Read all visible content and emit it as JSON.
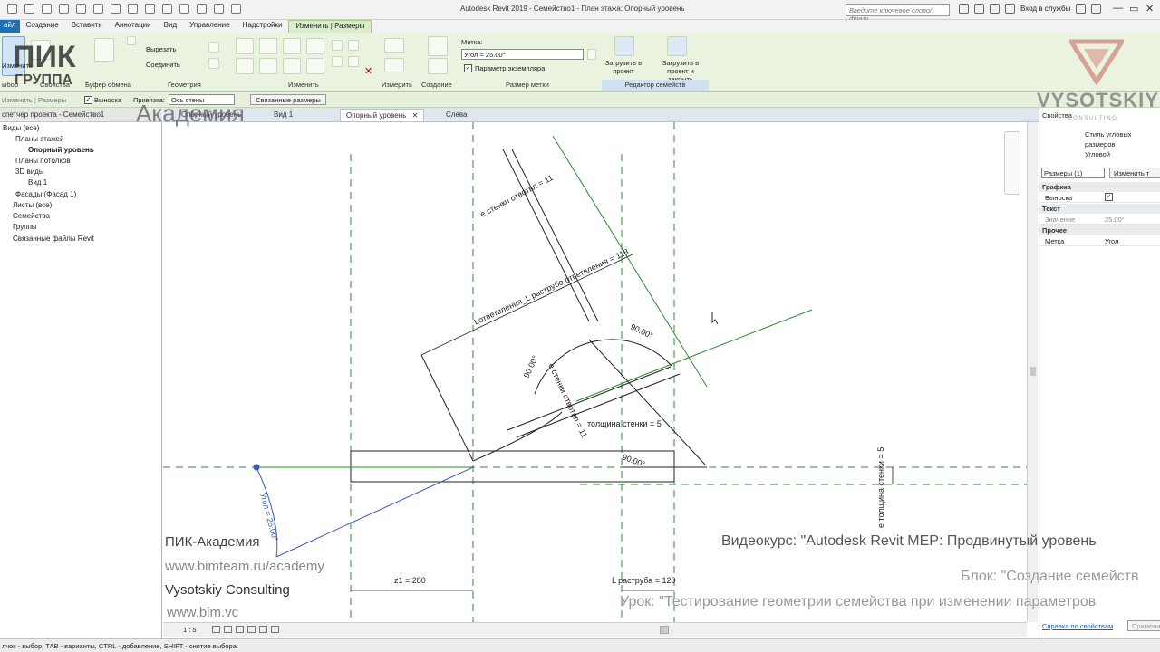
{
  "app": {
    "title": "Autodesk Revit 2019 - Семейство1 - План этажа: Опорный уровень",
    "search_placeholder": "Введите ключевое слово/фразу",
    "signin": "Вход в службы"
  },
  "tabs": [
    "айл",
    "Создание",
    "Вставить",
    "Аннотации",
    "Вид",
    "Управление",
    "Надстройки",
    "Изменить | Размеры"
  ],
  "ribbon": {
    "modify_label": "Изменить",
    "cut_label": "Вырезать",
    "join_label": "Соединить",
    "panels": {
      "select": "ыбор",
      "properties": "Свойства",
      "clipboard": "Буфер обмена",
      "geometry": "Геометрия",
      "modify": "Изменить",
      "measure": "Измерить",
      "create": "Создание",
      "label_size": "Размер метки",
      "family_editor": "Редактор семейств"
    },
    "label_title": "Метка:",
    "label_value": "Угол = 25.00°",
    "instance_param": "Параметр экземпляра",
    "load_into_project": "Загрузить в проект",
    "load_and_close": "Загрузить в проект и закрыть"
  },
  "options_bar": {
    "active_item": "Изменить | Размеры",
    "leader": "Выноска",
    "snap_label": "Привязка:",
    "snap_value": "Ось стены",
    "linked_dims": "Связанные размеры"
  },
  "doc_tabs": [
    {
      "label": "Опорный уровень",
      "active": false
    },
    {
      "label": "Вид 1",
      "active": false
    },
    {
      "label": "Опорный уровень",
      "active": true
    },
    {
      "label": "Слева",
      "active": false
    }
  ],
  "browser": {
    "title": "спетчер проекта - Семейство1",
    "items": [
      {
        "label": "Виды (все)",
        "bold": false
      },
      {
        "label": "Планы этажей",
        "bold": false
      },
      {
        "label": "Опорный уровень",
        "bold": true
      },
      {
        "label": "Планы потолков",
        "bold": false
      },
      {
        "label": "3D виды",
        "bold": false
      },
      {
        "label": "Вид 1",
        "bold": false
      },
      {
        "label": "Фасады (Фасад 1)",
        "bold": false
      },
      {
        "label": "Листы (все)",
        "bold": false
      },
      {
        "label": "Семейства",
        "bold": false
      },
      {
        "label": "Группы",
        "bold": false
      },
      {
        "label": "Связанные файлы Revit",
        "bold": false
      }
    ]
  },
  "properties": {
    "title": "Свойства",
    "type_name": "Стиль угловых размеров",
    "type_sub": "Угловой",
    "selector": "Размеры (1)",
    "edit_type": "Изменить т",
    "groups": {
      "graphics": "Графика",
      "text": "Текст",
      "other": "Прочее"
    },
    "rows": {
      "leader_label": "Выноска",
      "value_label": "Значение",
      "value_value": "25.00°",
      "label_label": "Метка",
      "label_value": "Угол"
    },
    "help_link": "Справка по свойствам",
    "apply": "Примени"
  },
  "canvas": {
    "dims": {
      "wall_offset_top": "е стенки отвотвл = 11",
      "branch_socket": "Lответвления_L раструбе ответвления = 118",
      "angle_90_a": "90.00°",
      "angle_90_b": "90.00°",
      "angle_90_c": "90.00°",
      "wall_offset_side": "е стенки отвотвл = 11",
      "wall_thickness": "толщина стенки = 5",
      "wall_thickness_v": "е толщина стенки = 5",
      "angle_param": "Угол = 25.00°",
      "z1": "z1 = 280",
      "socket_len": "L раструба = 120"
    }
  },
  "watermark": {
    "logo_top": "ПИК",
    "logo_bottom": "ГРУППА",
    "academy_big": "Академия",
    "academy": "ПИК-Академия",
    "url1": "www.bimteam.ru/academy",
    "company": "Vysotskiy Consulting",
    "url2": "www.bim.vc",
    "course": "Видеокурс: \"Autodesk Revit MEP: Продвинутый уровень",
    "block": "Блок: \"Создание семейств",
    "lesson": "Урок: \"Тестирование геометрии семейства при изменении параметров",
    "brand": "VYSOTSKIY",
    "brand_sub": "C O N S U L T I N G"
  },
  "view_control": {
    "scale": "1 : 5"
  },
  "status": {
    "hint": "лчок - выбор, TAB - варианты, CTRL - добавление, SHIFT - снятие выбора."
  },
  "colors": {
    "ribbon_bg": "#e9f3e0",
    "file_tab": "#1c70b5",
    "dim_green": "#2e8b2e"
  }
}
